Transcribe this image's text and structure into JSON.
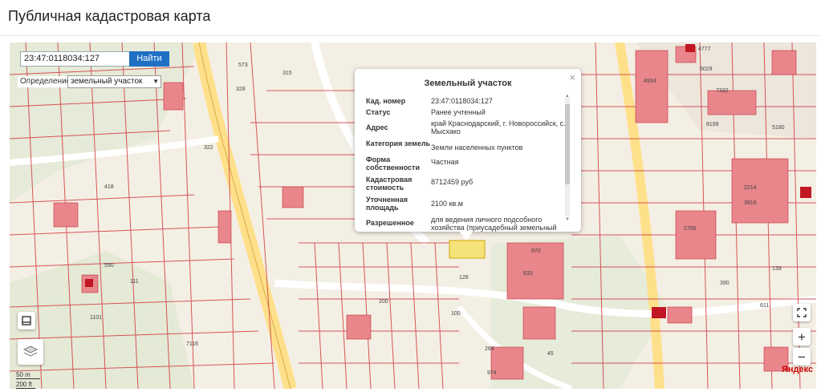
{
  "page": {
    "title": "Публичная кадастровая карта"
  },
  "search": {
    "value": "23:47:0118034:127",
    "button_label": "Найти"
  },
  "definition": {
    "label": "Определение",
    "selected": "земельный участок"
  },
  "popup": {
    "title": "Земельный участок",
    "rows": [
      {
        "key": "Кад. номер",
        "value": "23:47:0118034:127"
      },
      {
        "key": "Статус",
        "value": "Ранее учтенный"
      },
      {
        "key": "Адрес",
        "value": "край Краснодарский, г. Новороссийск, с. Мысхако"
      },
      {
        "key": "Категория земель",
        "value": "Земли населенных пунктов"
      },
      {
        "key": "Форма собственности",
        "value": "Частная"
      },
      {
        "key": "Кадастровая стоимость",
        "value": "8712459 руб"
      },
      {
        "key": "Уточненная площадь",
        "value": "2100 кв.м"
      },
      {
        "key": "Разрешенное",
        "value": "для ведения личного подсобного хозяйства (приусадебный земельный"
      }
    ]
  },
  "controls": {
    "zoom_in": "+",
    "zoom_out": "−",
    "scale_top": "50 m",
    "scale_bottom": "200 ft"
  },
  "map": {
    "logo": "Яндекс",
    "parcel_labels": [
      "573",
      "315",
      "328",
      "4777",
      "6029",
      "7332",
      "8199",
      "4934",
      "5180",
      "2214",
      "3916",
      "2706",
      "970",
      "633",
      "128",
      "100",
      "200",
      "590",
      "111",
      "45",
      "264",
      "974",
      "390",
      "139",
      "611",
      "418",
      "322",
      "1101",
      "7116"
    ]
  }
}
